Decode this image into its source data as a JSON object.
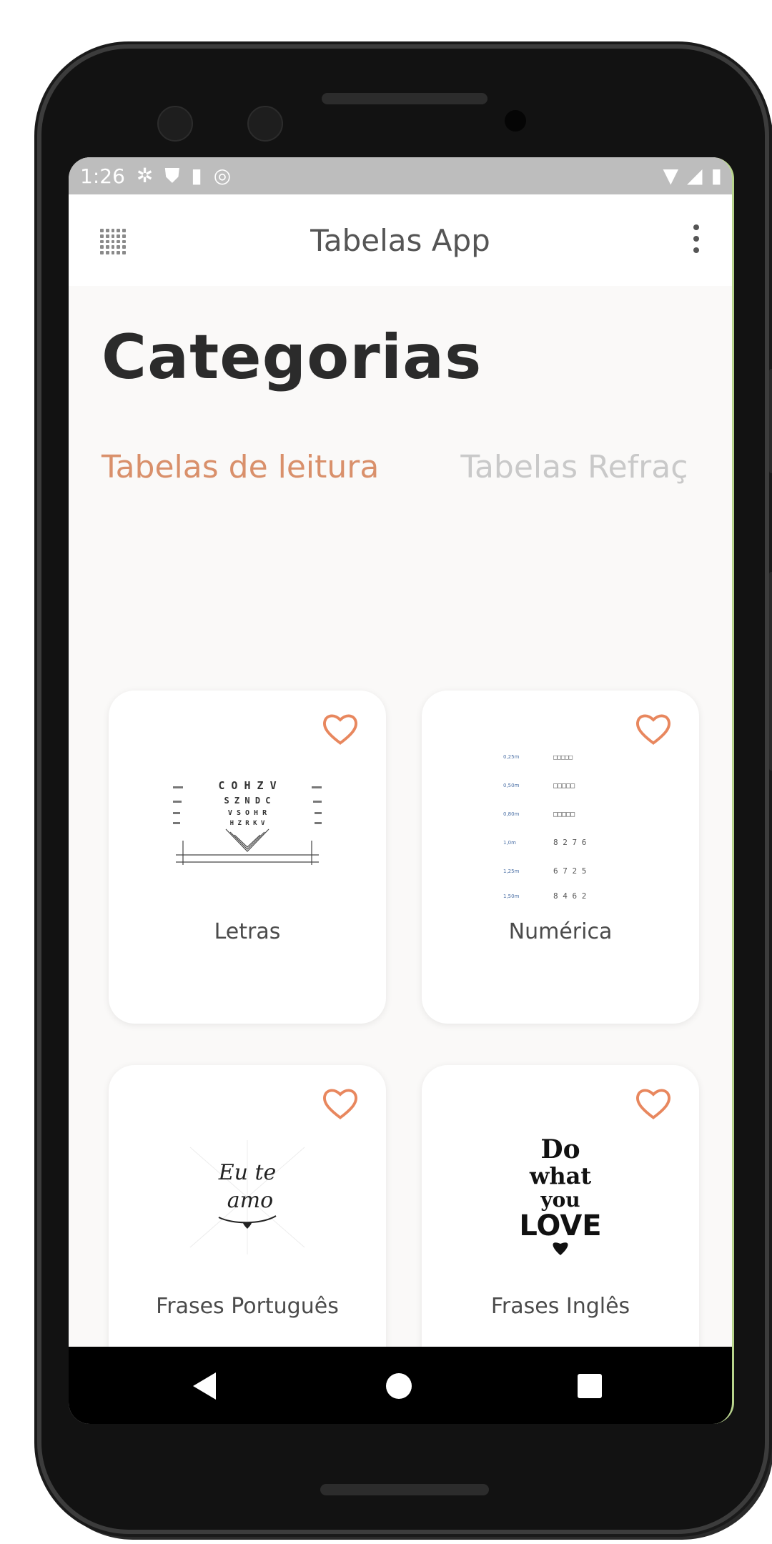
{
  "status_bar": {
    "time": "1:26",
    "icons_left": [
      "gear-icon",
      "play-shield-icon",
      "sd-card-icon",
      "at-sign-icon"
    ],
    "icons_right": [
      "wifi-icon",
      "signal-icon",
      "battery-icon"
    ]
  },
  "app_bar": {
    "title": "Tabelas App",
    "left_icon": "grid-menu-icon",
    "right_icon": "more-vert-icon"
  },
  "page": {
    "title": "Categorias"
  },
  "tabs": [
    {
      "label": "Tabelas de leitura",
      "active": true
    },
    {
      "label": "Tabelas Refraç",
      "active": false
    }
  ],
  "cards": [
    {
      "label": "Letras",
      "icon": "heart-outline-icon",
      "image": "letter-chart-thumbnail"
    },
    {
      "label": "Numérica",
      "icon": "heart-outline-icon",
      "image": "numeric-chart-thumbnail"
    },
    {
      "label": "Frases Português",
      "icon": "heart-outline-icon",
      "image": "eu-te-amo-thumbnail"
    },
    {
      "label": "Frases Inglês",
      "icon": "heart-outline-icon",
      "image": "do-what-you-love-thumbnail"
    }
  ],
  "thumb_text": {
    "letters_rows": [
      "C O H Z V",
      "S Z N D C",
      "V S O H R",
      "H Z R K V"
    ],
    "numeric_left": [
      "0,25m",
      "0,50m",
      "0,80m",
      "1,0m",
      "1,25m",
      "1,50m"
    ],
    "numeric_right": [
      "□□□□□",
      "□□□□□",
      "□□□□□",
      "8 2 7 6",
      "6 7 2 5",
      "8 4 6 2"
    ],
    "eu_te_amo": [
      "Eu te",
      "amo"
    ],
    "do_what_you_love": [
      "Do",
      "what",
      "you",
      "LOVE"
    ]
  },
  "colors": {
    "accent": "#d9906b",
    "status_bar": "#bdbdbd",
    "screen_bg": "#faf9f8",
    "inactive_tab": "#c9c9c9",
    "title_text": "#2b2b2b"
  },
  "nav_bar": {
    "buttons": [
      "back-icon",
      "home-icon",
      "recents-icon"
    ]
  }
}
